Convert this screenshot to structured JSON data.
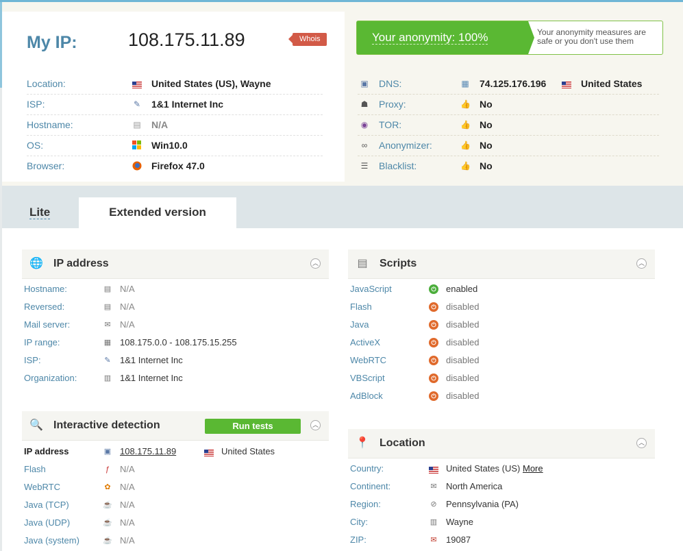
{
  "header": {
    "myip_label": "My IP:",
    "ip": "108.175.11.89",
    "whois": "Whois",
    "anonymity": "Your anonymity: 100%",
    "anonymity_note": "Your anonymity measures are safe or you don't use them",
    "left_rows": [
      {
        "label": "Location:",
        "value": "United States (US), Wayne",
        "icon": "us-flag-icon"
      },
      {
        "label": "ISP:",
        "value": "1&1 Internet Inc",
        "icon": "isp-icon"
      },
      {
        "label": "Hostname:",
        "value": "N/A",
        "icon": "server-icon"
      },
      {
        "label": "OS:",
        "value": "Win10.0",
        "icon": "windows-icon"
      },
      {
        "label": "Browser:",
        "value": "Firefox 47.0",
        "icon": "firefox-icon"
      }
    ],
    "right_rows": [
      {
        "label": "DNS:",
        "value": "74.125.176.196",
        "extra": "United States",
        "icon": "dns-icon"
      },
      {
        "label": "Proxy:",
        "value": "No",
        "icon": "spy-icon"
      },
      {
        "label": "TOR:",
        "value": "No",
        "icon": "onion-icon"
      },
      {
        "label": "Anonymizer:",
        "value": "No",
        "icon": "glasses-icon"
      },
      {
        "label": "Blacklist:",
        "value": "No",
        "icon": "list-icon"
      }
    ]
  },
  "tabs": {
    "lite": "Lite",
    "extended": "Extended version"
  },
  "ip_address": {
    "title": "IP address",
    "rows": [
      {
        "label": "Hostname:",
        "value": "N/A"
      },
      {
        "label": "Reversed:",
        "value": "N/A"
      },
      {
        "label": "Mail server:",
        "value": "N/A"
      },
      {
        "label": "IP range:",
        "value": "108.175.0.0 - 108.175.15.255"
      },
      {
        "label": "ISP:",
        "value": "1&1 Internet Inc"
      },
      {
        "label": "Organization:",
        "value": "1&1 Internet Inc"
      }
    ]
  },
  "interactive": {
    "title": "Interactive detection",
    "run_tests": "Run tests",
    "ip_label": "IP address",
    "ip_value": "108.175.11.89",
    "ip_country": "United States",
    "rows": [
      {
        "label": "Flash",
        "value": "N/A"
      },
      {
        "label": "WebRTC",
        "value": "N/A"
      },
      {
        "label": "Java (TCP)",
        "value": "N/A"
      },
      {
        "label": "Java (UDP)",
        "value": "N/A"
      },
      {
        "label": "Java (system)",
        "value": "N/A"
      }
    ]
  },
  "scripts": {
    "title": "Scripts",
    "rows": [
      {
        "label": "JavaScript",
        "value": "enabled",
        "on": true
      },
      {
        "label": "Flash",
        "value": "disabled",
        "on": false
      },
      {
        "label": "Java",
        "value": "disabled",
        "on": false
      },
      {
        "label": "ActiveX",
        "value": "disabled",
        "on": false
      },
      {
        "label": "WebRTC",
        "value": "disabled",
        "on": false
      },
      {
        "label": "VBScript",
        "value": "disabled",
        "on": false
      },
      {
        "label": "AdBlock",
        "value": "disabled",
        "on": false
      }
    ]
  },
  "location": {
    "title": "Location",
    "more": "More",
    "rows": [
      {
        "label": "Country:",
        "value": "United States (US)"
      },
      {
        "label": "Continent:",
        "value": "North America"
      },
      {
        "label": "Region:",
        "value": "Pennsylvania (PA)"
      },
      {
        "label": "City:",
        "value": "Wayne"
      },
      {
        "label": "ZIP:",
        "value": "19087"
      }
    ]
  },
  "colors": {
    "accent": "#4d87a8",
    "green": "#5ab833",
    "red": "#d25a47"
  }
}
